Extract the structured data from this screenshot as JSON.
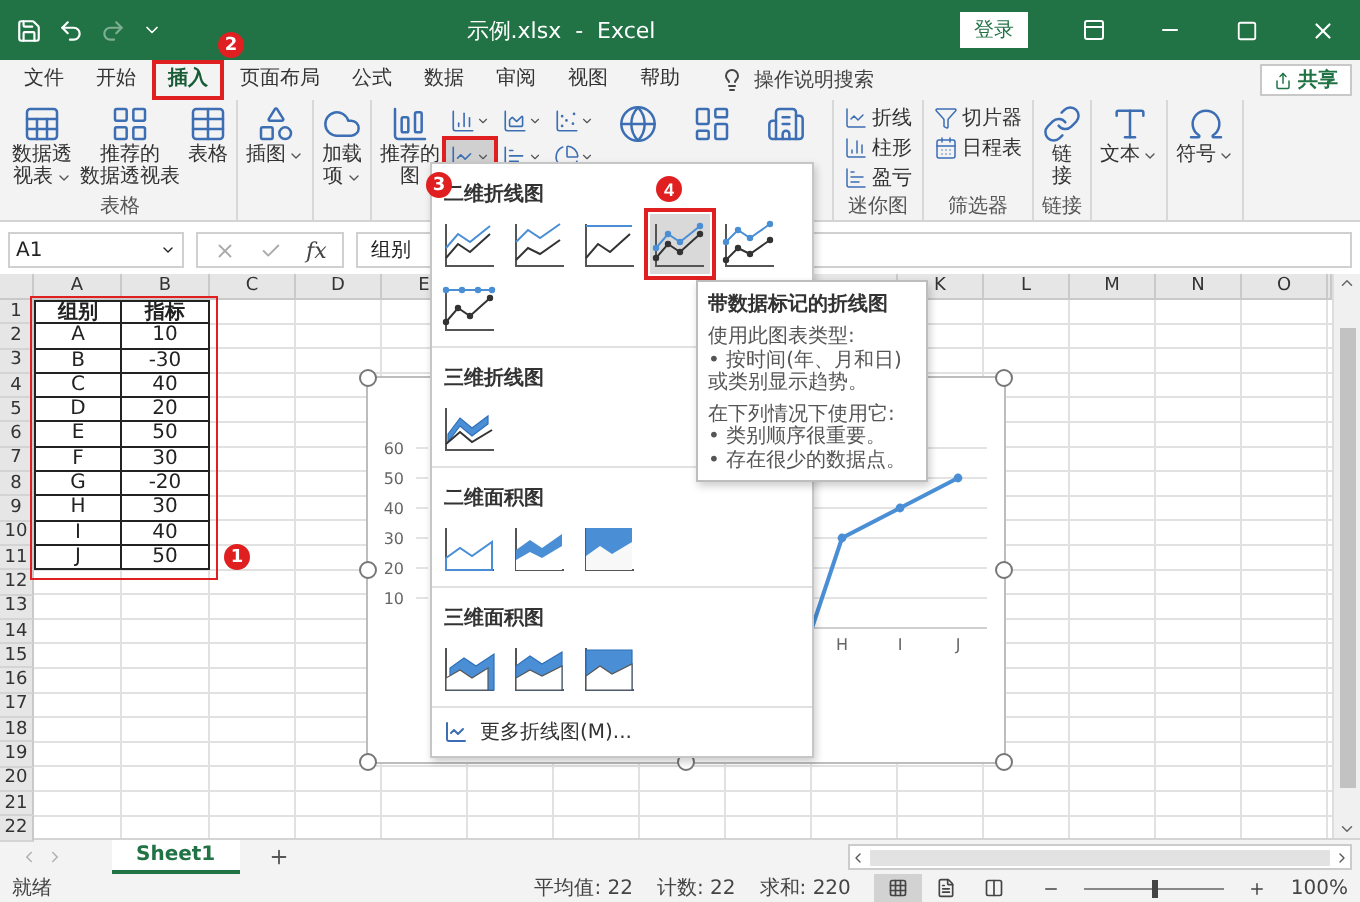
{
  "title_bar": {
    "title": "示例.xlsx  -  Excel",
    "sign_in": "登录"
  },
  "ribbon_tabs": [
    {
      "label": "文件",
      "selected": false
    },
    {
      "label": "开始",
      "selected": false
    },
    {
      "label": "插入",
      "selected": true,
      "annotation": "2"
    },
    {
      "label": "页面布局",
      "selected": false
    },
    {
      "label": "公式",
      "selected": false
    },
    {
      "label": "数据",
      "selected": false
    },
    {
      "label": "审阅",
      "selected": false
    },
    {
      "label": "视图",
      "selected": false
    },
    {
      "label": "帮助",
      "selected": false
    }
  ],
  "tell_me": "操作说明搜索",
  "share": "共享",
  "ribbon_groups": [
    {
      "label": "表格",
      "buttons": [
        {
          "kind": "large",
          "lines": [
            "数据透",
            "视表"
          ],
          "dropdown": true
        },
        {
          "kind": "large",
          "lines": [
            "推荐的",
            "数据透视表"
          ],
          "dropdown": false
        },
        {
          "kind": "large",
          "lines": [
            "表格"
          ],
          "dropdown": false
        }
      ]
    },
    {
      "buttons": [
        {
          "kind": "large",
          "lines": [
            "插图"
          ],
          "dropdown": true
        }
      ]
    },
    {
      "buttons": [
        {
          "kind": "large",
          "lines": [
            "加载",
            "项"
          ],
          "dropdown": true
        }
      ]
    },
    {
      "buttons": [
        {
          "kind": "large",
          "lines": [
            "推荐的",
            "图"
          ],
          "dropdown": false
        },
        {
          "kind": "chart",
          "selected": false
        },
        {
          "kind": "chart",
          "selected": false
        },
        {
          "kind": "chart",
          "selected": false
        },
        {
          "kind": "chart",
          "selected": true,
          "annotation": "3"
        },
        {
          "kind": "chart",
          "selected": false
        },
        {
          "kind": "chart",
          "selected": false
        },
        {
          "kind": "large",
          "dropdown": false
        },
        {
          "kind": "large",
          "dropdown": false
        },
        {
          "kind": "large",
          "dropdown": false
        }
      ]
    },
    {
      "label": "迷你图",
      "buttons": [
        {
          "kind": "small",
          "lines": [
            "折线"
          ]
        },
        {
          "kind": "small",
          "lines": [
            "柱形"
          ]
        },
        {
          "kind": "small",
          "lines": [
            "盈亏"
          ]
        }
      ]
    },
    {
      "label": "筛选器",
      "buttons": [
        {
          "kind": "small",
          "lines": [
            "切片器"
          ]
        },
        {
          "kind": "small",
          "lines": [
            "日程表"
          ]
        }
      ]
    },
    {
      "label": "链接",
      "buttons": [
        {
          "kind": "large",
          "lines": [
            "链",
            "接"
          ],
          "dropdown": false
        }
      ]
    },
    {
      "buttons": [
        {
          "kind": "large",
          "lines": [
            "文本"
          ],
          "dropdown": true
        }
      ]
    },
    {
      "buttons": [
        {
          "kind": "large",
          "lines": [
            "符号"
          ],
          "dropdown": true
        }
      ]
    }
  ],
  "formula_bar": {
    "name_box": "A1",
    "function_label": "fx",
    "value": "组别"
  },
  "sheet": {
    "annotation": "1",
    "columns": [
      {
        "label": "A"
      },
      {
        "label": "B"
      },
      {
        "label": "C"
      },
      {
        "label": "D"
      },
      {
        "label": "E"
      },
      {},
      {},
      {},
      {},
      {},
      {
        "label": "K"
      },
      {
        "label": "L"
      },
      {
        "label": "M"
      },
      {
        "label": "N"
      },
      {
        "label": "O"
      }
    ],
    "rows": [
      {
        "number": "1",
        "cells": [
          "组别",
          "指标"
        ]
      },
      {
        "number": "2",
        "cells": [
          "A",
          "10"
        ]
      },
      {
        "number": "3",
        "cells": [
          "B",
          "-30"
        ]
      },
      {
        "number": "4",
        "cells": [
          "C",
          "40"
        ]
      },
      {
        "number": "5",
        "cells": [
          "D",
          "20"
        ]
      },
      {
        "number": "6",
        "cells": [
          "E",
          "50"
        ]
      },
      {
        "number": "7",
        "cells": [
          "F",
          "30"
        ]
      },
      {
        "number": "8",
        "cells": [
          "G",
          "-20"
        ]
      },
      {
        "number": "9",
        "cells": [
          "H",
          "30"
        ]
      },
      {
        "number": "10",
        "cells": [
          "I",
          "40"
        ]
      },
      {
        "number": "11",
        "cells": [
          "J",
          "50"
        ]
      },
      {
        "number": "12"
      },
      {
        "number": "13"
      },
      {
        "number": "14"
      },
      {
        "number": "15"
      },
      {
        "number": "16"
      },
      {
        "number": "17"
      },
      {
        "number": "18"
      },
      {
        "number": "19"
      },
      {
        "number": "20"
      },
      {
        "number": "21"
      },
      {
        "number": "22"
      }
    ]
  },
  "chart": {
    "y_labels": [
      "60",
      "50",
      "40",
      "30",
      "20",
      "10"
    ],
    "x_labels": [
      "H",
      "I",
      "J"
    ]
  },
  "chart_menu": {
    "sections": [
      {
        "title": "二维折线图",
        "items": [
          {
            "kind": "line",
            "selected": false
          },
          {
            "kind": "stacked-line",
            "selected": false
          },
          {
            "kind": "percent-line",
            "selected": false
          },
          {
            "kind": "line-markers",
            "selected": true,
            "annotation": "4"
          },
          {
            "kind": "stacked-line-markers",
            "selected": false
          },
          {
            "kind": "percent-line-markers",
            "selected": false
          }
        ]
      },
      {
        "title": "三维折线图",
        "items": [
          {
            "kind": "line3d",
            "selected": false
          }
        ]
      },
      {
        "title": "二维面积图",
        "items": [
          {
            "kind": "area",
            "selected": false
          },
          {
            "kind": "stacked-area",
            "selected": false
          },
          {
            "kind": "percent-area",
            "selected": false
          }
        ]
      },
      {
        "title": "三维面积图",
        "items": [
          {
            "kind": "area3d",
            "selected": false
          },
          {
            "kind": "stackedarea3d",
            "selected": false
          },
          {
            "kind": "percentarea3d",
            "selected": false
          }
        ]
      }
    ],
    "more": "更多折线图(M)..."
  },
  "tooltip": {
    "title": "带数据标记的折线图",
    "paragraphs": [
      {
        "lines": [
          "使用此图表类型:",
          "• 按时间(年、月和日)",
          "或类别显示趋势。"
        ]
      },
      {
        "lines": [
          "在下列情况下使用它:",
          "• 类别顺序很重要。",
          "• 存在很少的数据点。"
        ]
      }
    ]
  },
  "sheet_tabs": [
    {
      "label": "Sheet1",
      "selected": true
    }
  ],
  "status_bar": {
    "ready": "就绪",
    "stats": [
      "平均值: 22",
      "计数: 22",
      "求和: 220"
    ],
    "views": [
      {
        "selected": true
      },
      {
        "selected": false
      },
      {
        "selected": false
      }
    ],
    "zoom": {
      "level": 0.5,
      "reading": "100%"
    }
  }
}
